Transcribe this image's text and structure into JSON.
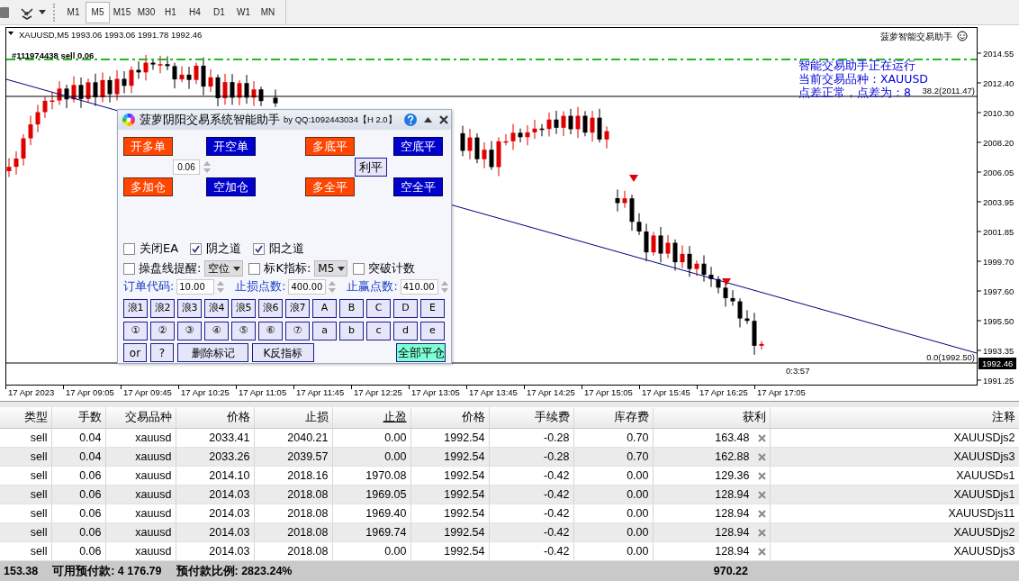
{
  "toolbar": {
    "timeframes": [
      {
        "label": "M1",
        "selected": false
      },
      {
        "label": "M5",
        "selected": true
      },
      {
        "label": "M15",
        "selected": false
      },
      {
        "label": "M30",
        "selected": false
      },
      {
        "label": "H1",
        "selected": false
      },
      {
        "label": "H4",
        "selected": false
      },
      {
        "label": "D1",
        "selected": false
      },
      {
        "label": "W1",
        "selected": false
      },
      {
        "label": "MN",
        "selected": false
      }
    ]
  },
  "chart": {
    "header": "XAUUSD,M5 1993.06 1993.06 1991.78 1992.46",
    "order_label": "#111974438 sell 0.06",
    "ea_title": "菠萝智能交易助手",
    "status_lines": [
      "智能交易助手正在运行",
      "当前交易品种：XAUUSD",
      "点差正常，点差为：8"
    ],
    "levels": [
      {
        "label": "38.2(2011.47)"
      },
      {
        "label": "0.0(1992.50)"
      }
    ],
    "countdown": "0:3:57",
    "price_ticks": [
      "2014.55",
      "2012.40",
      "2010.30",
      "2008.20",
      "2006.05",
      "2003.95",
      "2001.85",
      "1999.70",
      "1997.60",
      "1995.50",
      "1993.35",
      "1991.25"
    ],
    "current_price": "1992.46",
    "time_labels": [
      "17 Apr 2023",
      "17 Apr 09:05",
      "17 Apr 09:45",
      "17 Apr 10:25",
      "17 Apr 11:05",
      "17 Apr 11:45",
      "17 Apr 12:25",
      "17 Apr 13:05",
      "17 Apr 13:45",
      "17 Apr 14:25",
      "17 Apr 15:05",
      "17 Apr 15:45",
      "17 Apr 16:25",
      "17 Apr 17:05"
    ]
  },
  "panel": {
    "title": "菠萝阴阳交易系统智能助手",
    "subtitle": "by QQ:1092443034【H 2.0】",
    "trade_buttons": [
      {
        "label": "开多单",
        "kind": "long"
      },
      {
        "label": "开空单",
        "kind": "short"
      },
      {
        "label": "多底平",
        "kind": "long"
      },
      {
        "label": "空底平",
        "kind": "short"
      },
      {
        "label": "多加仓",
        "kind": "long"
      },
      {
        "label": "空加仓",
        "kind": "short"
      },
      {
        "label": "多全平",
        "kind": "long"
      },
      {
        "label": "空全平",
        "kind": "short"
      }
    ],
    "lot": "0.06",
    "profit_close_button": "利平",
    "options": [
      [
        {
          "kind": "checkbox",
          "label": "关闭EA",
          "checked": false
        },
        {
          "kind": "checkbox",
          "label": "阴之道",
          "checked": true
        },
        {
          "kind": "checkbox",
          "label": "阳之道",
          "checked": true
        }
      ],
      [
        {
          "kind": "checkbox",
          "label": "操盘线提醒:",
          "checked": false
        },
        {
          "kind": "select",
          "value": "空位"
        },
        {
          "kind": "checkbox",
          "label": "标K指标:",
          "checked": false
        },
        {
          "kind": "select",
          "value": "M5"
        },
        {
          "kind": "checkbox",
          "label": "突破计数",
          "checked": false
        }
      ]
    ],
    "inputs": [
      {
        "label": "订单代码:",
        "value": "10.00"
      },
      {
        "label": "止损点数:",
        "value": "400.00"
      },
      {
        "label": "止赢点数:",
        "value": "410.00"
      }
    ],
    "mark_buttons": [
      "浪1",
      "浪2",
      "浪3",
      "浪4",
      "浪5",
      "浪6",
      "浪7",
      "A",
      "B",
      "C",
      "D",
      "E",
      "①",
      "②",
      "③",
      "④",
      "⑤",
      "⑥",
      "⑦",
      "a",
      "b",
      "c",
      "d",
      "e"
    ],
    "bottom_buttons": [
      {
        "label": "or",
        "kind": "plain"
      },
      {
        "label": "?",
        "kind": "plain"
      },
      {
        "label": "删除标记",
        "kind": "plain"
      },
      {
        "label": "K反指标",
        "kind": "plain"
      },
      {
        "label": "全部平仓",
        "kind": "accent"
      }
    ]
  },
  "table": {
    "columns": [
      {
        "label": "类型",
        "sorted": false
      },
      {
        "label": "手数",
        "sorted": false
      },
      {
        "label": "交易品种",
        "sorted": false
      },
      {
        "label": "价格",
        "sorted": false
      },
      {
        "label": "止损",
        "sorted": false
      },
      {
        "label": "止盈",
        "sorted": true
      },
      {
        "label": "价格",
        "sorted": false
      },
      {
        "label": "手续费",
        "sorted": false
      },
      {
        "label": "库存费",
        "sorted": false
      },
      {
        "label": "获利",
        "sorted": false
      },
      {
        "label": "注释",
        "sorted": false
      }
    ],
    "rows": [
      [
        "sell",
        "0.04",
        "xauusd",
        "2033.41",
        "2040.21",
        "0.00",
        "1992.54",
        "-0.28",
        "0.70",
        "163.48",
        "XAUUSDjs2"
      ],
      [
        "sell",
        "0.04",
        "xauusd",
        "2033.26",
        "2039.57",
        "0.00",
        "1992.54",
        "-0.28",
        "0.70",
        "162.88",
        "XAUUSDjs3"
      ],
      [
        "sell",
        "0.06",
        "xauusd",
        "2014.10",
        "2018.16",
        "1970.08",
        "1992.54",
        "-0.42",
        "0.00",
        "129.36",
        "XAUUSDs1"
      ],
      [
        "sell",
        "0.06",
        "xauusd",
        "2014.03",
        "2018.08",
        "1969.05",
        "1992.54",
        "-0.42",
        "0.00",
        "128.94",
        "XAUUSDjs1"
      ],
      [
        "sell",
        "0.06",
        "xauusd",
        "2014.03",
        "2018.08",
        "1969.40",
        "1992.54",
        "-0.42",
        "0.00",
        "128.94",
        "XAUUSDjs11"
      ],
      [
        "sell",
        "0.06",
        "xauusd",
        "2014.03",
        "2018.08",
        "1969.74",
        "1992.54",
        "-0.42",
        "0.00",
        "128.94",
        "XAUUSDjs2"
      ],
      [
        "sell",
        "0.06",
        "xauusd",
        "2014.03",
        "2018.08",
        "0.00",
        "1992.54",
        "-0.42",
        "0.00",
        "128.94",
        "XAUUSDjs3"
      ]
    ]
  },
  "footer": {
    "balance": "153.38",
    "items": [
      "可用预付款: 4 176.79",
      "预付款比例: 2823.24%"
    ],
    "total": "970.22"
  }
}
